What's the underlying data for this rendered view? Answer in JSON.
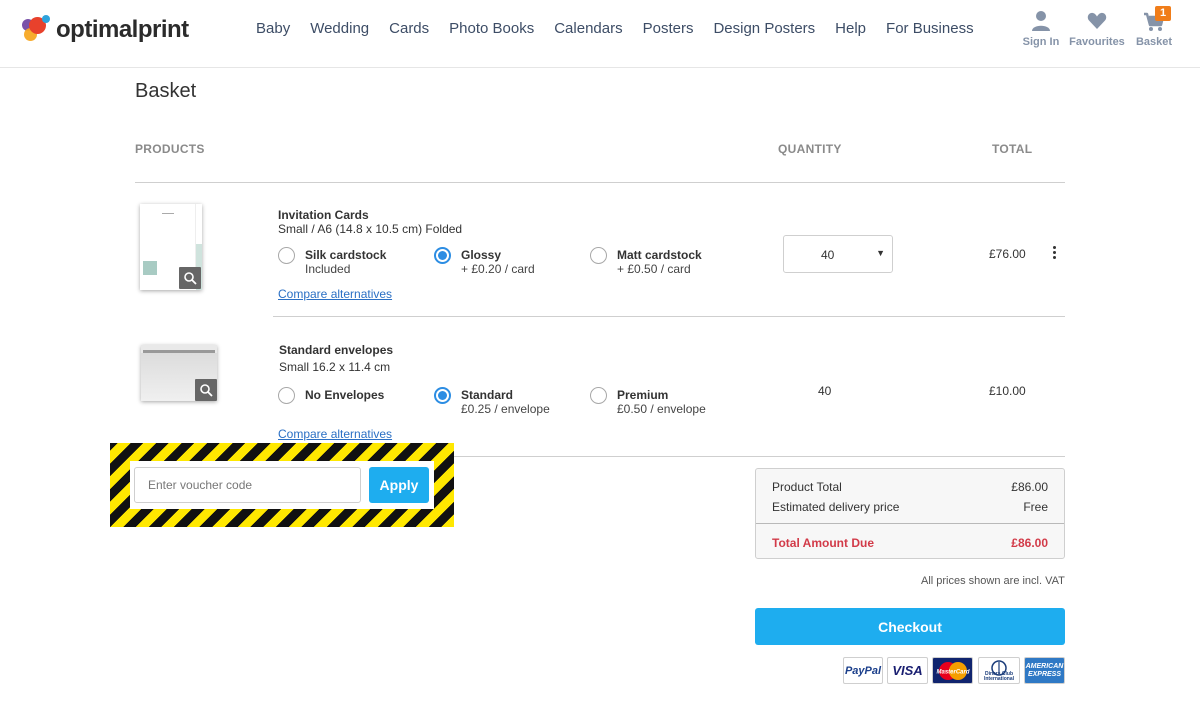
{
  "header": {
    "logo_text": "optimalprint",
    "nav": [
      "Baby",
      "Wedding",
      "Cards",
      "Photo Books",
      "Calendars",
      "Posters",
      "Design Posters",
      "Help",
      "For Business"
    ],
    "sign_in": "Sign In",
    "favourites": "Favourites",
    "basket": "Basket",
    "basket_count": "1"
  },
  "page": {
    "title": "Basket",
    "col_products": "PRODUCTS",
    "col_quantity": "QUANTITY",
    "col_total": "TOTAL"
  },
  "items": [
    {
      "name": "Invitation Cards",
      "spec": "Small / A6 (14.8 x 10.5 cm) Folded",
      "options": [
        {
          "label": "Silk cardstock",
          "sub": "Included",
          "selected": false
        },
        {
          "label": "Glossy",
          "sub": "+ £0.20 / card",
          "selected": true
        },
        {
          "label": "Matt cardstock",
          "sub": "+ £0.50 / card",
          "selected": false
        }
      ],
      "compare": "Compare alternatives",
      "quantity": "40",
      "total": "£76.00"
    },
    {
      "name": "Standard envelopes",
      "spec": "Small 16.2 x 11.4 cm",
      "options": [
        {
          "label": "No Envelopes",
          "sub": "",
          "selected": false
        },
        {
          "label": "Standard",
          "sub": "£0.25 / envelope",
          "selected": true
        },
        {
          "label": "Premium",
          "sub": "£0.50 / envelope",
          "selected": false
        }
      ],
      "compare": "Compare alternatives",
      "quantity": "40",
      "total": "£10.00"
    }
  ],
  "voucher": {
    "placeholder": "Enter voucher code",
    "apply": "Apply"
  },
  "summary": {
    "product_total_label": "Product Total",
    "product_total": "£86.00",
    "delivery_label": "Estimated delivery price",
    "delivery": "Free",
    "amount_due_label": "Total Amount Due",
    "amount_due": "£86.00",
    "vat_note": "All prices shown are incl. VAT",
    "checkout": "Checkout"
  },
  "payment_methods": {
    "paypal": "PayPal",
    "visa": "VISA",
    "mastercard": "MasterCard",
    "diners": "Diners Club International",
    "amex": "AMERICAN EXPRESS"
  },
  "colors": {
    "accent": "#1eadef",
    "radio_selected": "#2c8de3",
    "total_due": "#d23a48",
    "badge": "#f07d1a",
    "hazard_yellow": "#ffe800"
  }
}
